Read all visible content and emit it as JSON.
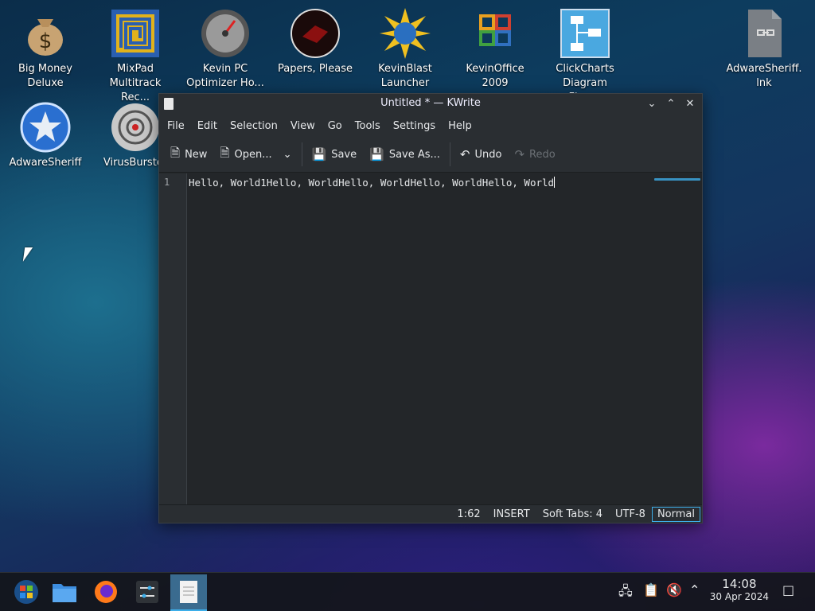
{
  "desktop": {
    "icons": [
      {
        "label": "Big Money\nDeluxe",
        "icon": "money-bag-icon"
      },
      {
        "label": "MixPad\nMultitrack Rec...",
        "icon": "mixpad-icon"
      },
      {
        "label": "Kevin PC\nOptimizer Ho...",
        "icon": "gauge-icon"
      },
      {
        "label": "Papers, Please",
        "icon": "papers-please-icon"
      },
      {
        "label": "KevinBlast\nLauncher",
        "icon": "starburst-globe-icon"
      },
      {
        "label": "KevinOffice\n2009",
        "icon": "office-icon"
      },
      {
        "label": "ClickCharts\nDiagram Flow...",
        "icon": "flowchart-icon"
      },
      {
        "label": "AdwareSheriff.\nlnk",
        "icon": "shortcut-file-icon"
      },
      {
        "label": "AdwareSheriff",
        "icon": "sheriff-badge-icon"
      },
      {
        "label": "VirusBurster",
        "icon": "virus-target-icon"
      }
    ]
  },
  "window": {
    "title": "Untitled * — KWrite",
    "menu": [
      "File",
      "Edit",
      "Selection",
      "View",
      "Go",
      "Tools",
      "Settings",
      "Help"
    ],
    "toolbar": {
      "new": "New",
      "open": "Open...",
      "save": "Save",
      "save_as": "Save As...",
      "undo": "Undo",
      "redo": "Redo"
    },
    "editor": {
      "line_number": "1",
      "text": "Hello, World1Hello, WorldHello, WorldHello, WorldHello, World"
    },
    "status": {
      "position": "1:62",
      "input_mode": "INSERT",
      "indent": "Soft Tabs: 4",
      "encoding": "UTF-8",
      "mode": "Normal"
    }
  },
  "taskbar": {
    "clock_time": "14:08",
    "clock_date": "30 Apr 2024"
  },
  "colors": {
    "accent": "#3daee9"
  }
}
